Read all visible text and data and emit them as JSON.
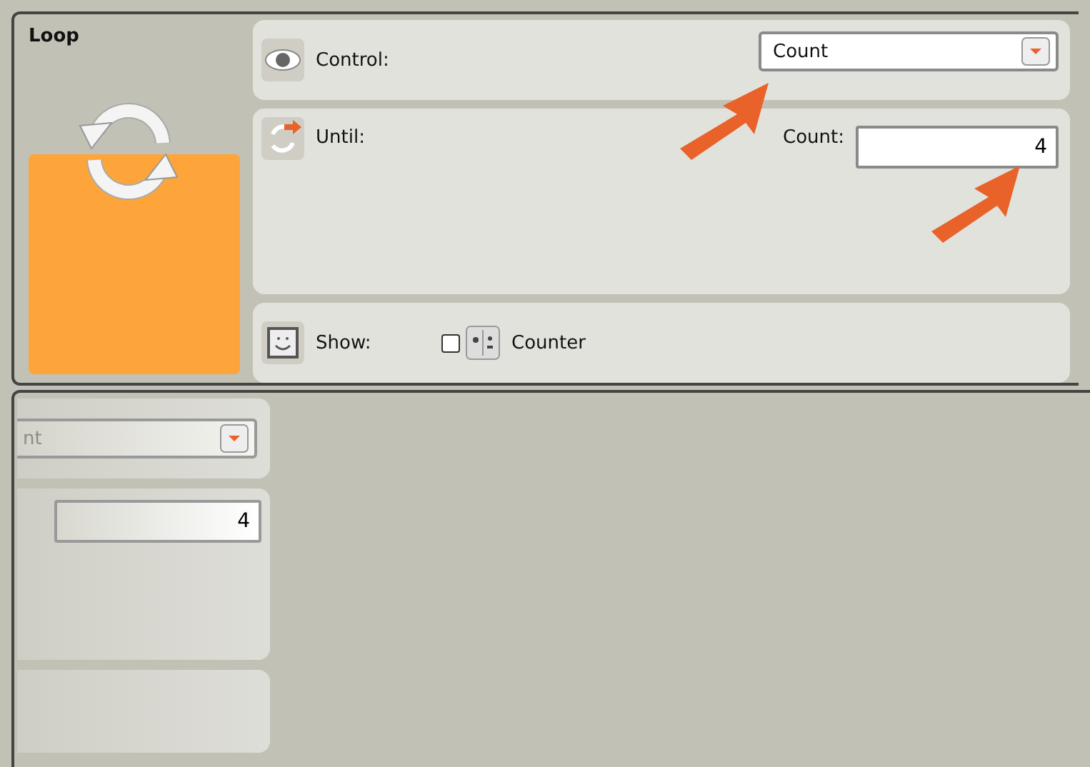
{
  "block": {
    "title": "Loop"
  },
  "control": {
    "label": "Control:",
    "value": "Count"
  },
  "until": {
    "label": "Until:",
    "count_label": "Count:",
    "count_value": "4"
  },
  "show": {
    "label": "Show:",
    "checked": false,
    "option": "Counter"
  },
  "faded_copy": {
    "dropdown_text": "nt",
    "count_value": "4"
  }
}
